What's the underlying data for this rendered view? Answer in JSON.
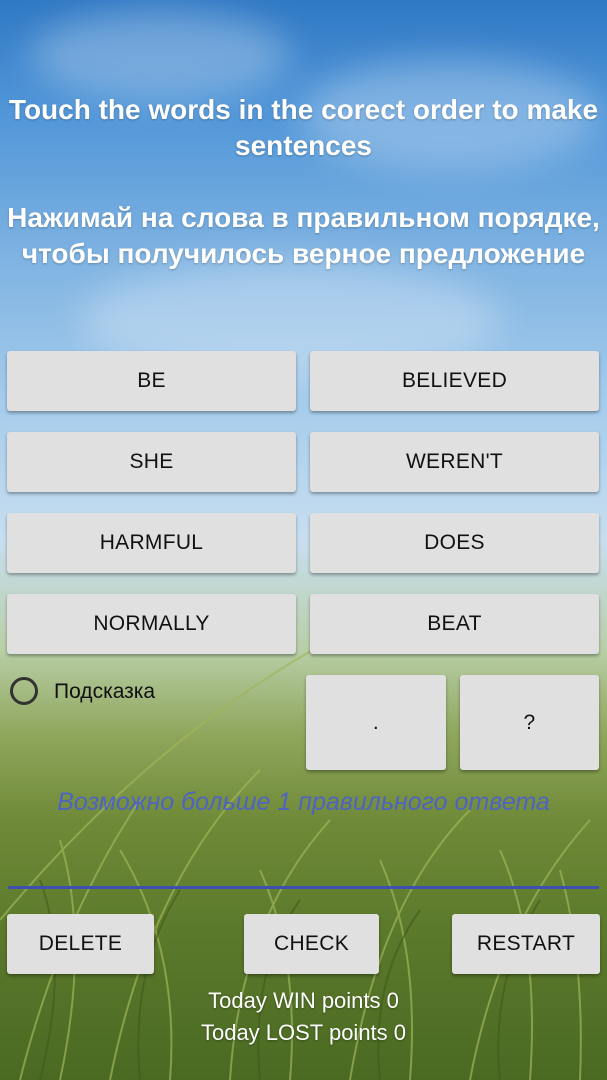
{
  "header": {
    "title_en": "Touch the words in the corect order to make sentences",
    "title_ru": "Нажимай на слова в правильном порядке, чтобы получилось верное предложение"
  },
  "words": [
    "BE",
    "BELIEVED",
    "SHE",
    "WEREN'T",
    "HARMFUL",
    "DOES",
    "NORMALLY",
    "BEAT"
  ],
  "hint": {
    "label": "Подсказка",
    "checked": false
  },
  "punctuation": [
    ".",
    "?"
  ],
  "notice": "Возможно больше 1 правильного ответа",
  "answer": "",
  "actions": {
    "delete": "DELETE",
    "check": "CHECK",
    "restart": "RESTART"
  },
  "stats": {
    "win": "Today WIN points 0",
    "lost": "Today LOST points 0"
  }
}
